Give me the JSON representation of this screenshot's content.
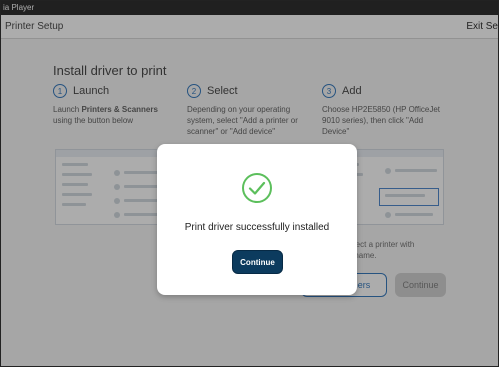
{
  "os_titlebar": {
    "text": "ia Player"
  },
  "app": {
    "title": "Printer Setup",
    "exit_label": "Exit Se"
  },
  "content": {
    "heading": "Install driver to print",
    "steps": [
      {
        "number": "1",
        "title": "Launch",
        "desc_pre": "Launch ",
        "desc_bold": "Printers & Scanners",
        "desc_post": " using the button below"
      },
      {
        "number": "2",
        "title": "Select",
        "desc": "Depending on your operating system, select \"Add a printer or scanner\" or \"Add device\""
      },
      {
        "number": "3",
        "title": "Add",
        "desc": "Choose HP2E5850 (HP OfficeJet 9010 series), then click \"Add Device\""
      }
    ],
    "behind_text": {
      "line1": "t select a printer with",
      "line2": "the name."
    },
    "buttons": {
      "partial_outline_label": "nners",
      "continue_bg_label": "Continue"
    }
  },
  "modal": {
    "message": "Print driver successfully installed",
    "continue_label": "Continue",
    "icon": "checkmark-circle-icon",
    "accent": "#5cbf5c",
    "button_color": "#0c3b5e"
  }
}
